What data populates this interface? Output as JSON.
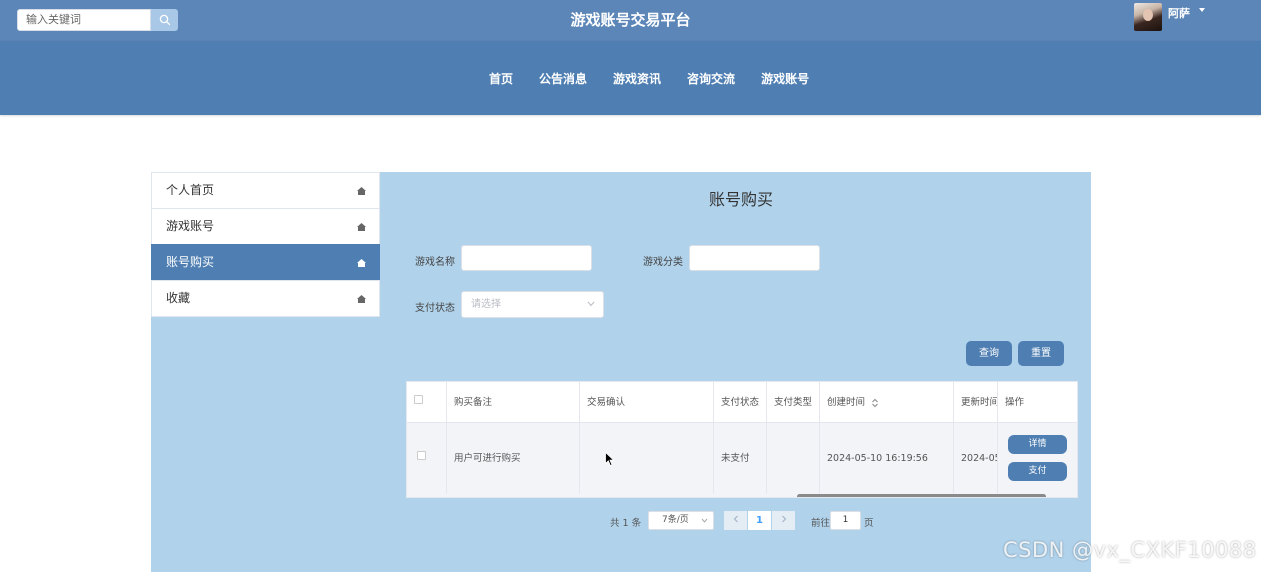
{
  "header": {
    "search_placeholder": "输入关键词",
    "site_title": "游戏账号交易平台",
    "user_name": "阿萨"
  },
  "nav": {
    "items": [
      "首页",
      "公告消息",
      "游戏资讯",
      "咨询交流",
      "游戏账号"
    ]
  },
  "sidebar": {
    "items": [
      {
        "label": "个人首页",
        "active": false
      },
      {
        "label": "游戏账号",
        "active": false
      },
      {
        "label": "账号购买",
        "active": true
      },
      {
        "label": "收藏",
        "active": false
      }
    ]
  },
  "main": {
    "title": "账号购买",
    "filters": {
      "game_name_label": "游戏名称",
      "game_category_label": "游戏分类",
      "pay_status_label": "支付状态",
      "pay_status_placeholder": "请选择"
    },
    "buttons": {
      "query": "查询",
      "reset": "重置"
    },
    "table": {
      "columns": [
        "购买备注",
        "交易确认",
        "支付状态",
        "支付类型",
        "创建时间",
        "更新时间",
        "操作"
      ],
      "rows": [
        {
          "note": "用户可进行购买",
          "confirm": "",
          "pay_status": "未支付",
          "pay_type": "",
          "created": "2024-05-10 16:19:56",
          "updated": "2024-05-",
          "actions": [
            "详情",
            "支付"
          ]
        }
      ]
    },
    "pagination": {
      "total_text": "共 1 条",
      "page_size": "7条/页",
      "current_page": "1",
      "goto_label": "前往",
      "goto_value": "1",
      "page_suffix": "页"
    }
  },
  "watermark": "CSDN @vx_CXKF10088",
  "colors": {
    "header": "#5b86b7",
    "nav": "#4f7fb2",
    "panel": "#b0d2eb",
    "accent": "#4f7fb2",
    "page_active": "#409eff"
  }
}
